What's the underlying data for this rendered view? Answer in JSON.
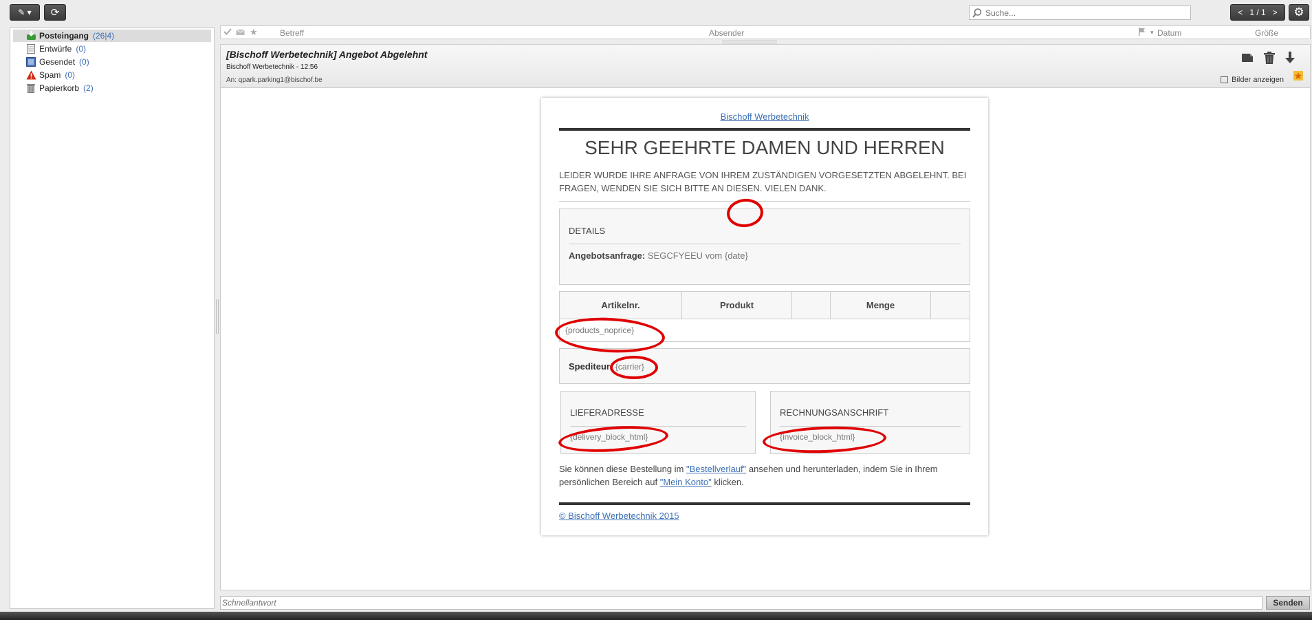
{
  "toolbar": {
    "compose_label": "✎ ▾",
    "refresh_label": "⟳",
    "search_placeholder": "Suche...",
    "pager_prev": "<",
    "pager_text": "1 / 1",
    "pager_next": ">",
    "settings_label": "⚙"
  },
  "sidebar": {
    "folders": [
      {
        "icon": "inbox-icon",
        "label": "Posteingang",
        "count": "(26|4)",
        "active": true
      },
      {
        "icon": "drafts-icon",
        "label": "Entwürfe",
        "count": "(0)"
      },
      {
        "icon": "sent-icon",
        "label": "Gesendet",
        "count": "(0)"
      },
      {
        "icon": "spam-warning-icon",
        "label": "Spam",
        "count": "(0)"
      },
      {
        "icon": "trash-icon",
        "label": "Papierkorb",
        "count": "(2)"
      }
    ]
  },
  "list_header": {
    "subject": "Betreff",
    "sender": "Absender",
    "date": "Datum",
    "size": "Größe"
  },
  "message": {
    "subject": "[Bischoff Werbetechnik] Angebot Abgelehnt",
    "from_line": "Bischoff Werbetechnik - 12:56",
    "to_line": "An: qpark.parking1@bischof.be",
    "show_images": "Bilder anzeigen"
  },
  "email": {
    "brand_link": "Bischoff Werbetechnik",
    "heading": "SEHR GEEHRTE DAMEN UND HERREN",
    "intro": "LEIDER WURDE IHRE ANFRAGE VON IHREM ZUSTÄNDIGEN VORGESETZTEN ABGELEHNT. BEI FRAGEN, WENDEN SIE SICH BITTE AN DIESEN. VIELEN DANK.",
    "details_title": "DETAILS",
    "request_label": "Angebotsanfrage:",
    "request_value": "SEGCFYEEU",
    "request_from": "vom",
    "request_date": "{date}",
    "table_headers": [
      "Artikelnr.",
      "Produkt",
      "",
      "Menge",
      ""
    ],
    "products_placeholder": "{products_noprice}",
    "carrier_label": "Spediteur:",
    "carrier_value": "{carrier}",
    "delivery_title": "LIEFERADRESSE",
    "delivery_value": "{delivery_block_html}",
    "invoice_title": "RECHNUNGSANSCHRIFT",
    "invoice_value": "{invoice_block_html}",
    "outro_1": "Sie können diese Bestellung im ",
    "outro_link_1": "\"Bestellverlauf\"",
    "outro_2": " ansehen und herunterladen, indem Sie in Ihrem persönlichen Bereich auf ",
    "outro_link_2": "\"Mein Konto\"",
    "outro_3": " klicken.",
    "copyright": "© Bischoff Werbetechnik 2015"
  },
  "reply": {
    "placeholder": "Schnellantwort",
    "send_label": "Senden"
  },
  "colors": {
    "accent_link": "#3b6fb6",
    "annotation_red": "#e00000"
  }
}
